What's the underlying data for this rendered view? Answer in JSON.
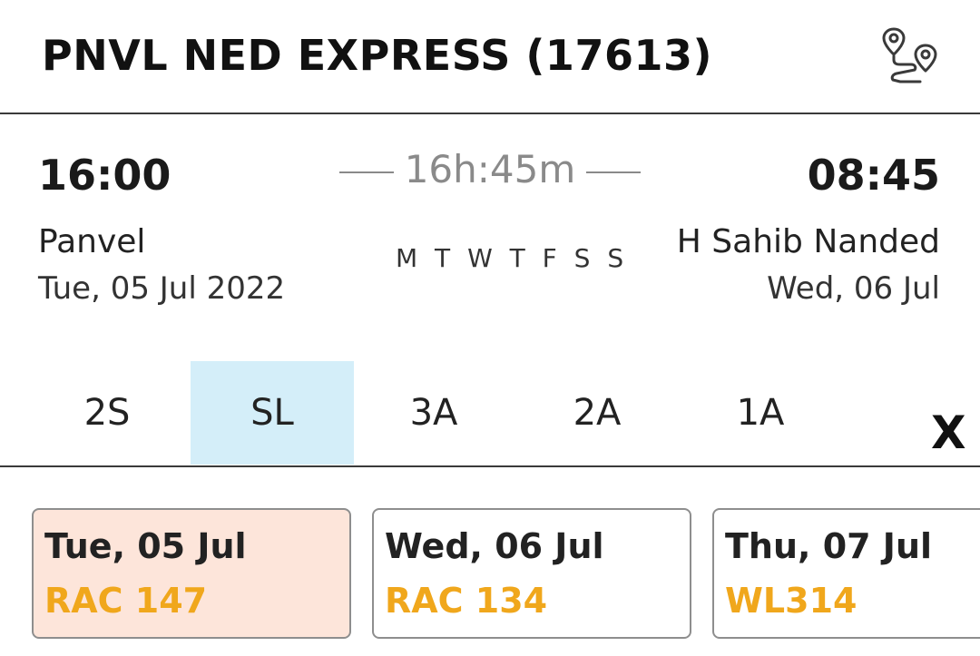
{
  "header": {
    "title": "PNVL NED EXPRESS (17613)",
    "route_icon": "route-map-pin-icon"
  },
  "journey": {
    "departure": {
      "time": "16:00",
      "station": "Panvel",
      "date": "Tue, 05 Jul  2022"
    },
    "arrival": {
      "time": "08:45",
      "station": "H Sahib Nanded",
      "date": "Wed, 06 Jul"
    },
    "duration": "16h:45m",
    "running_days": "M T W T F S S"
  },
  "classes": {
    "tabs": [
      "2S",
      "SL",
      "3A",
      "2A",
      "1A"
    ],
    "selected": "SL",
    "close_label": "X"
  },
  "availability": [
    {
      "date": "Tue, 05 Jul",
      "status": "RAC 147",
      "selected": true
    },
    {
      "date": "Wed, 06 Jul",
      "status": "RAC 134",
      "selected": false
    },
    {
      "date": "Thu, 07 Jul",
      "status": "WL314",
      "selected": false
    }
  ],
  "colors": {
    "status": "#f0a71c",
    "selected_class_bg": "#d4eef9",
    "selected_card_bg": "#fde5da"
  }
}
